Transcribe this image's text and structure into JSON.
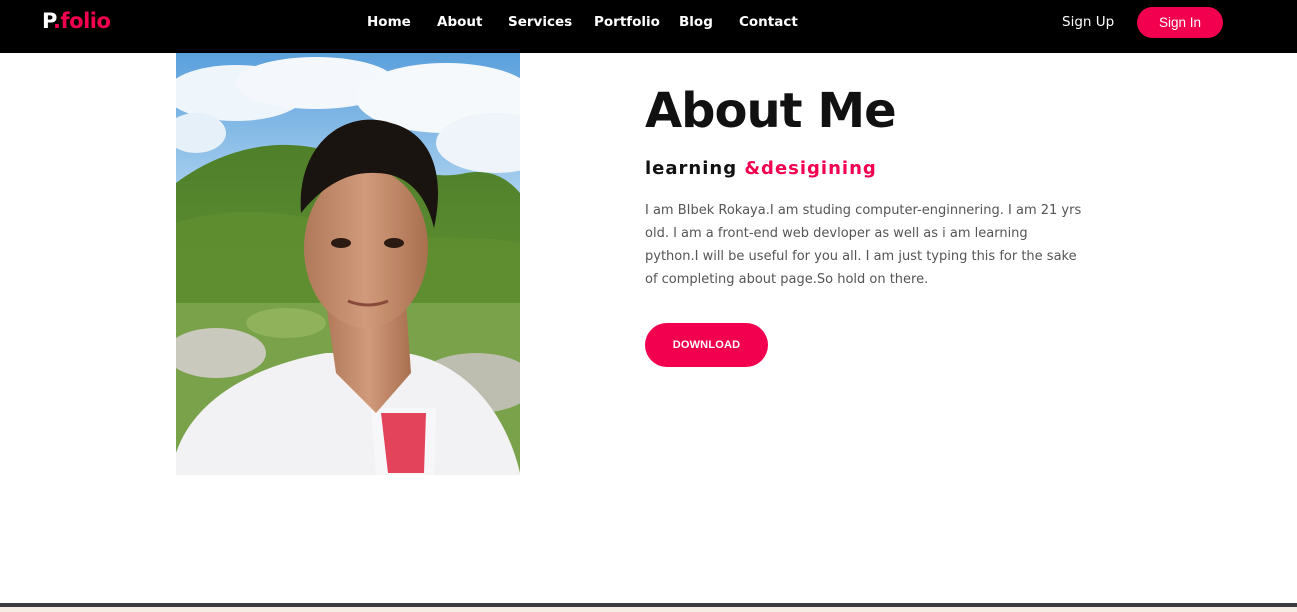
{
  "brand": {
    "logo_prefix": "P",
    "logo_dot": ".",
    "logo_suffix": "folio"
  },
  "nav": {
    "items": [
      {
        "label": "Home"
      },
      {
        "label": "About"
      },
      {
        "label": "Services"
      },
      {
        "label": "Portfolio"
      },
      {
        "label": "Blog"
      },
      {
        "label": "Contact"
      }
    ],
    "sign_up": "Sign Up",
    "sign_in": "Sign In"
  },
  "about": {
    "title": "About Me",
    "subtitle_plain": "learning ",
    "subtitle_accent": "&desigining",
    "bio": "I am BIbek Rokaya.I am studing computer-enginnering. I am 21 yrs old. I am a front-end web devloper as well as i am learning python.I will be useful for you all. I am just typing this for the sake of completing about page.So hold on there.",
    "button": "DOWNLOAD"
  },
  "colors": {
    "accent": "#f2004f",
    "nav_bg": "#000000",
    "text_dark": "#111111",
    "text_body": "#555555"
  }
}
